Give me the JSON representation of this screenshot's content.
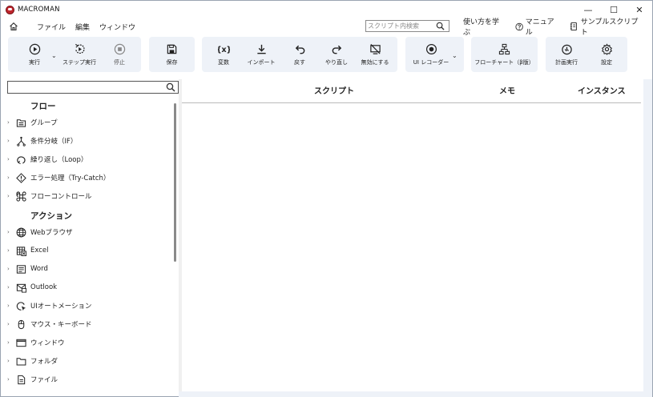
{
  "window": {
    "title": "MACROMAN",
    "controls": {
      "minimize": "—",
      "maximize": "☐",
      "close": "✕"
    }
  },
  "menubar": {
    "items": [
      "ファイル",
      "編集",
      "ウィンドウ"
    ],
    "search_placeholder": "スクリプト内検索",
    "help_links": [
      {
        "label": "使い方を学ぶ",
        "icon": "none"
      },
      {
        "label": "マニュアル",
        "icon": "question-circle-icon"
      },
      {
        "label": "サンプルスクリプト",
        "icon": "sample-script-icon"
      }
    ]
  },
  "toolbar": {
    "run": "実行",
    "step_run": "ステップ実行",
    "stop": "停止",
    "save": "保存",
    "variables": "変数",
    "import": "インポート",
    "undo": "戻す",
    "redo": "やり直し",
    "disable": "無効にする",
    "ui_recorder": "UI レコーダー",
    "flowchart": "フローチャート（β版）",
    "scheduled_run": "計画実行",
    "settings": "設定"
  },
  "sidebar": {
    "search_value": "",
    "sections": [
      {
        "header": "フロー",
        "items": [
          {
            "label": "グループ",
            "icon": "group-icon"
          },
          {
            "label": "条件分岐（IF）",
            "icon": "branch-icon"
          },
          {
            "label": "繰り返し（Loop）",
            "icon": "loop-icon"
          },
          {
            "label": "エラー処理（Try-Catch）",
            "icon": "error-diamond-icon"
          },
          {
            "label": "フローコントロール",
            "icon": "command-icon"
          }
        ]
      },
      {
        "header": "アクション",
        "items": [
          {
            "label": "Webブラウザ",
            "icon": "globe-icon"
          },
          {
            "label": "Excel",
            "icon": "excel-icon"
          },
          {
            "label": "Word",
            "icon": "word-icon"
          },
          {
            "label": "Outlook",
            "icon": "outlook-icon"
          },
          {
            "label": "UIオートメーション",
            "icon": "ui-automation-icon"
          },
          {
            "label": "マウス・キーボード",
            "icon": "mouse-icon"
          },
          {
            "label": "ウィンドウ",
            "icon": "window-icon"
          },
          {
            "label": "フォルダ",
            "icon": "folder-icon"
          },
          {
            "label": "ファイル",
            "icon": "file-icon"
          }
        ]
      }
    ]
  },
  "main": {
    "columns": [
      "スクリプト",
      "メモ",
      "インスタンス"
    ],
    "rows": []
  },
  "colors": {
    "toolbar_group_bg": "#eef2f8",
    "logo_red": "#c0262d",
    "text": "#222222"
  }
}
